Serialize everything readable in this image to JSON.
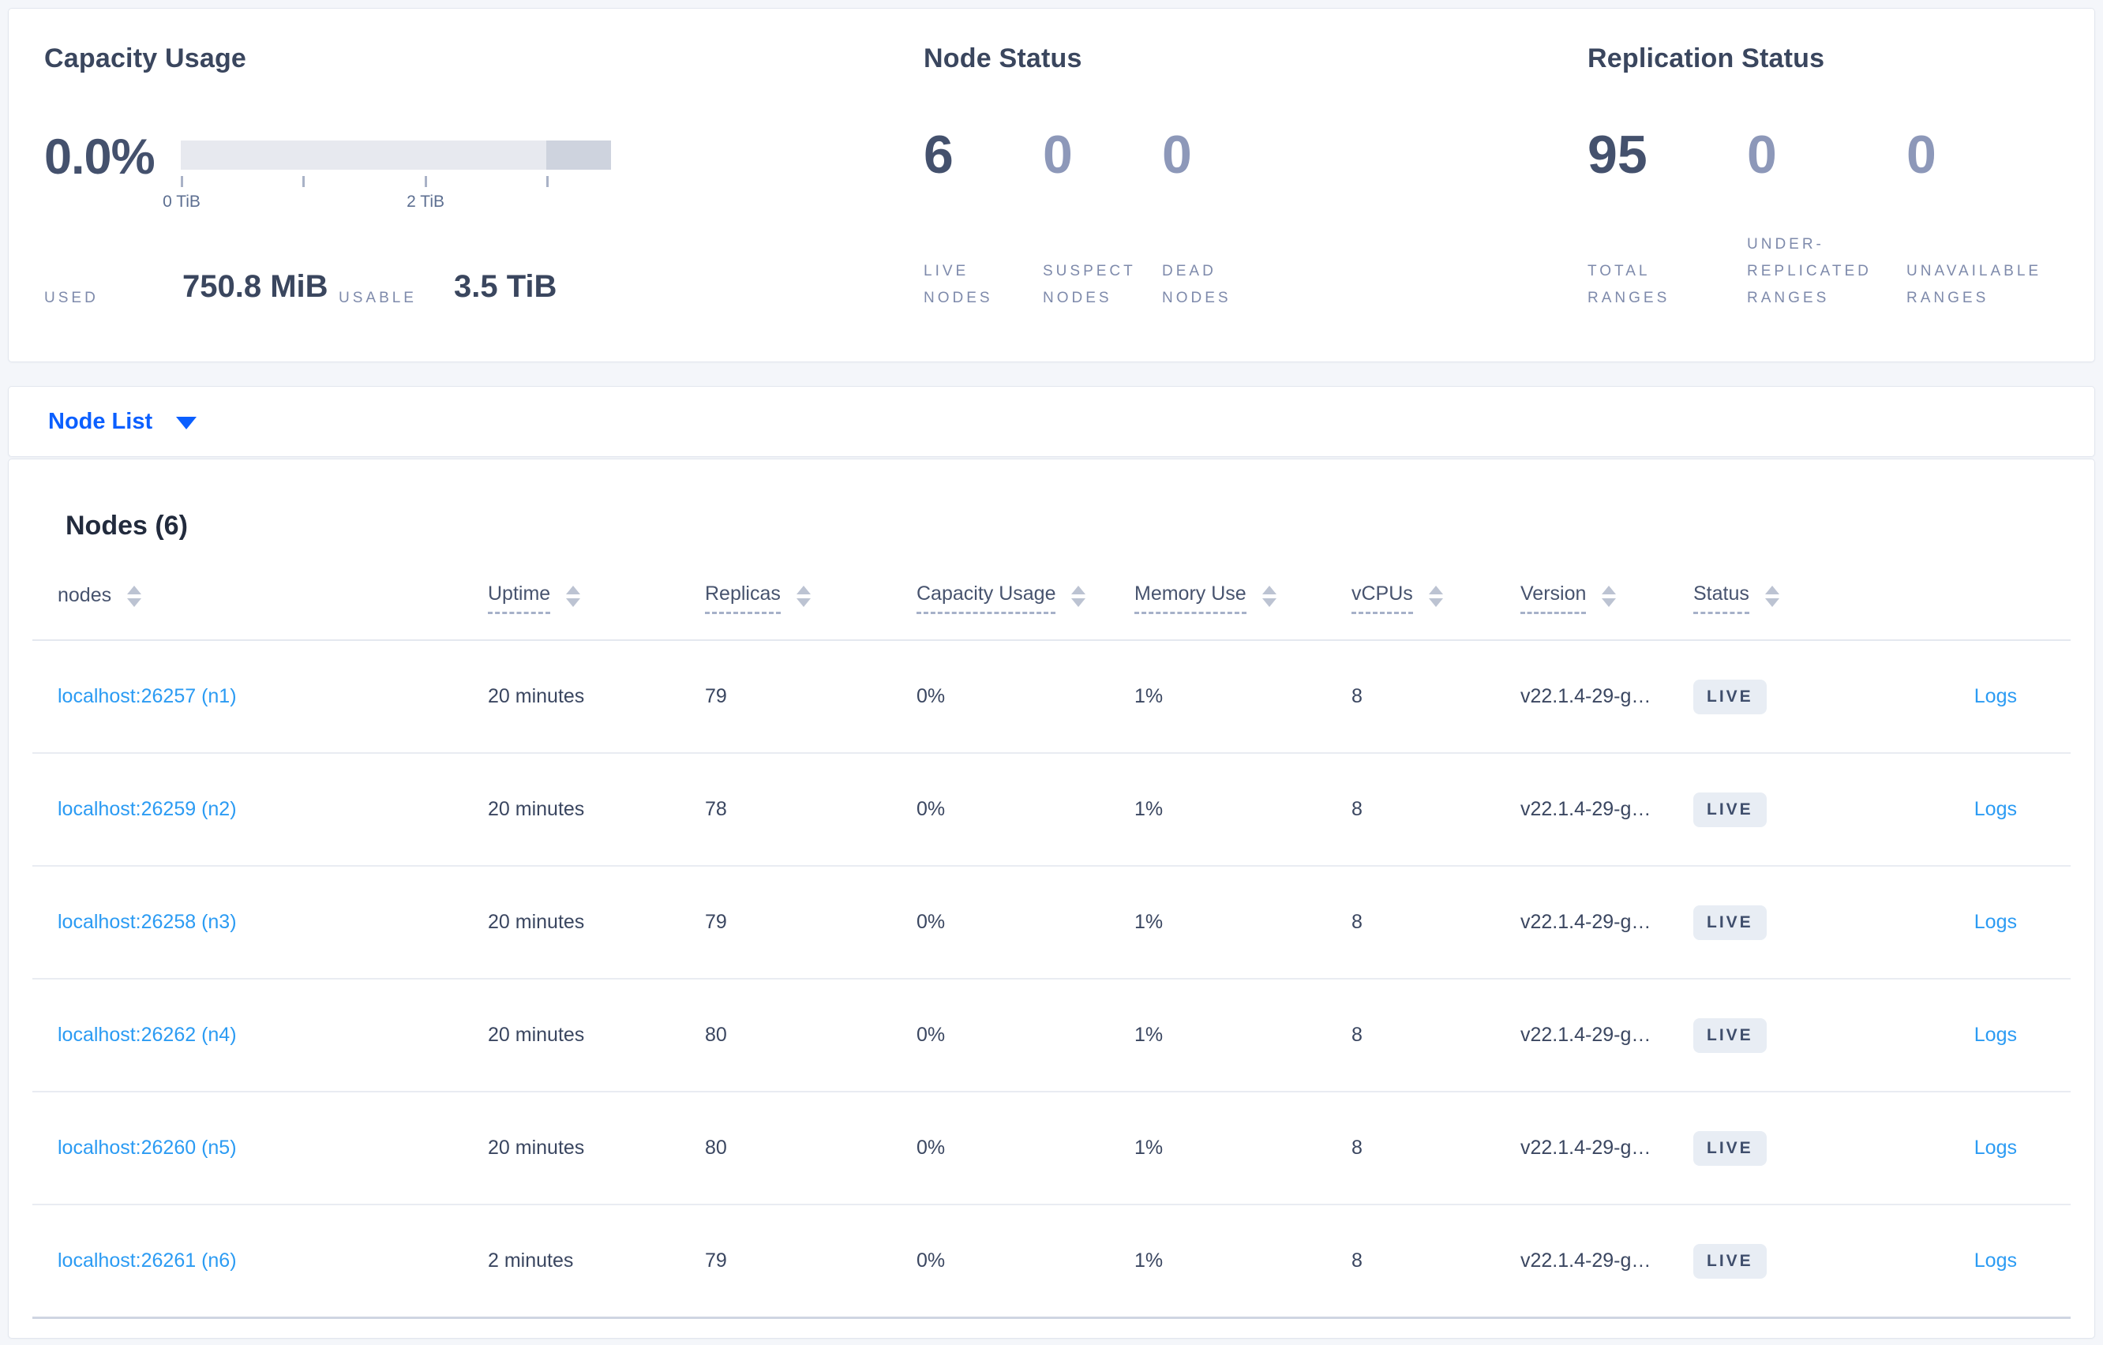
{
  "colors": {
    "accent_blue": "#0b5fff",
    "link_blue": "#2b9bf3",
    "badge_bg": "#e8edf4",
    "bar_light": "#e7e9ef",
    "bar_dark": "#ced3de",
    "page_bg": "#f4f6fa"
  },
  "capacity": {
    "title": "Capacity Usage",
    "percent": "0.0%",
    "tick_label_0": "0 TiB",
    "tick_label_2": "2 TiB",
    "used_label": "USED",
    "used_value": "750.8 MiB",
    "usable_label": "USABLE",
    "usable_value": "3.5 TiB"
  },
  "node_status": {
    "title": "Node Status",
    "stats": [
      {
        "value": "6",
        "label": "LIVE NODES"
      },
      {
        "value": "0",
        "label": "SUSPECT NODES"
      },
      {
        "value": "0",
        "label": "DEAD NODES"
      }
    ]
  },
  "replication": {
    "title": "Replication Status",
    "stats": [
      {
        "value": "95",
        "label": "TOTAL RANGES"
      },
      {
        "value": "0",
        "label": "UNDER-REPLICATED RANGES"
      },
      {
        "value": "0",
        "label": "UNAVAILABLE RANGES"
      }
    ]
  },
  "node_list": {
    "label": "Node List"
  },
  "nodes_table": {
    "title": "Nodes (6)",
    "columns": [
      "nodes",
      "Uptime",
      "Replicas",
      "Capacity Usage",
      "Memory Use",
      "vCPUs",
      "Version",
      "Status"
    ],
    "logs_label": "Logs",
    "rows": [
      {
        "node": "localhost:26257 (n1)",
        "uptime": "20 minutes",
        "replicas": "79",
        "capacity": "0%",
        "memory": "1%",
        "vcpus": "8",
        "version": "v22.1.4-29-g…",
        "status": "LIVE"
      },
      {
        "node": "localhost:26259 (n2)",
        "uptime": "20 minutes",
        "replicas": "78",
        "capacity": "0%",
        "memory": "1%",
        "vcpus": "8",
        "version": "v22.1.4-29-g…",
        "status": "LIVE"
      },
      {
        "node": "localhost:26258 (n3)",
        "uptime": "20 minutes",
        "replicas": "79",
        "capacity": "0%",
        "memory": "1%",
        "vcpus": "8",
        "version": "v22.1.4-29-g…",
        "status": "LIVE"
      },
      {
        "node": "localhost:26262 (n4)",
        "uptime": "20 minutes",
        "replicas": "80",
        "capacity": "0%",
        "memory": "1%",
        "vcpus": "8",
        "version": "v22.1.4-29-g…",
        "status": "LIVE"
      },
      {
        "node": "localhost:26260 (n5)",
        "uptime": "20 minutes",
        "replicas": "80",
        "capacity": "0%",
        "memory": "1%",
        "vcpus": "8",
        "version": "v22.1.4-29-g…",
        "status": "LIVE"
      },
      {
        "node": "localhost:26261 (n6)",
        "uptime": "2 minutes",
        "replicas": "79",
        "capacity": "0%",
        "memory": "1%",
        "vcpus": "8",
        "version": "v22.1.4-29-g…",
        "status": "LIVE"
      }
    ]
  }
}
